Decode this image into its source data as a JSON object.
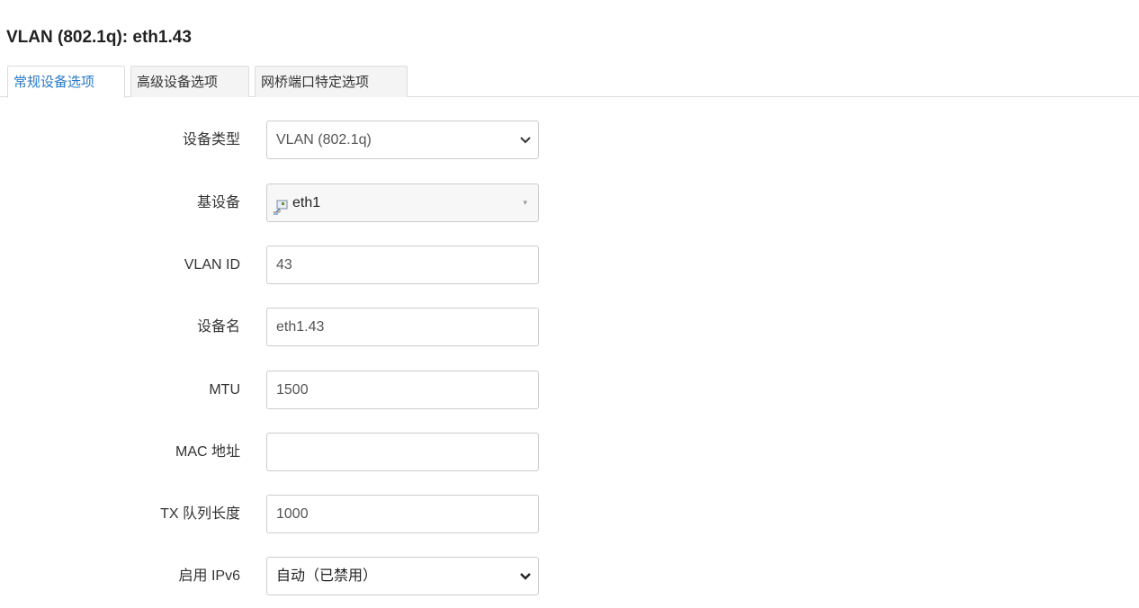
{
  "page": {
    "title": "VLAN (802.1q): eth1.43"
  },
  "tabs": [
    {
      "label": "常规设备选项",
      "active": true
    },
    {
      "label": "高级设备选项",
      "active": false
    },
    {
      "label": "网桥端口特定选项",
      "active": false
    }
  ],
  "fields": {
    "device_type": {
      "label": "设备类型",
      "value": "VLAN (802.1q)"
    },
    "base_device": {
      "label": "基设备",
      "value": "eth1",
      "icon": "network-port-icon"
    },
    "vlan_id": {
      "label": "VLAN ID",
      "value": "43"
    },
    "device_name": {
      "label": "设备名",
      "value": "eth1.43"
    },
    "mtu": {
      "label": "MTU",
      "value": "1500"
    },
    "mac_address": {
      "label": "MAC 地址",
      "value": ""
    },
    "tx_queue_length": {
      "label": "TX 队列长度",
      "value": "1000"
    },
    "enable_ipv6": {
      "label": "启用 IPv6",
      "value": "自动（已禁用）"
    }
  },
  "colors": {
    "active_tab_text": "#2a7ac6",
    "border": "#cccccc",
    "text": "#333333"
  }
}
